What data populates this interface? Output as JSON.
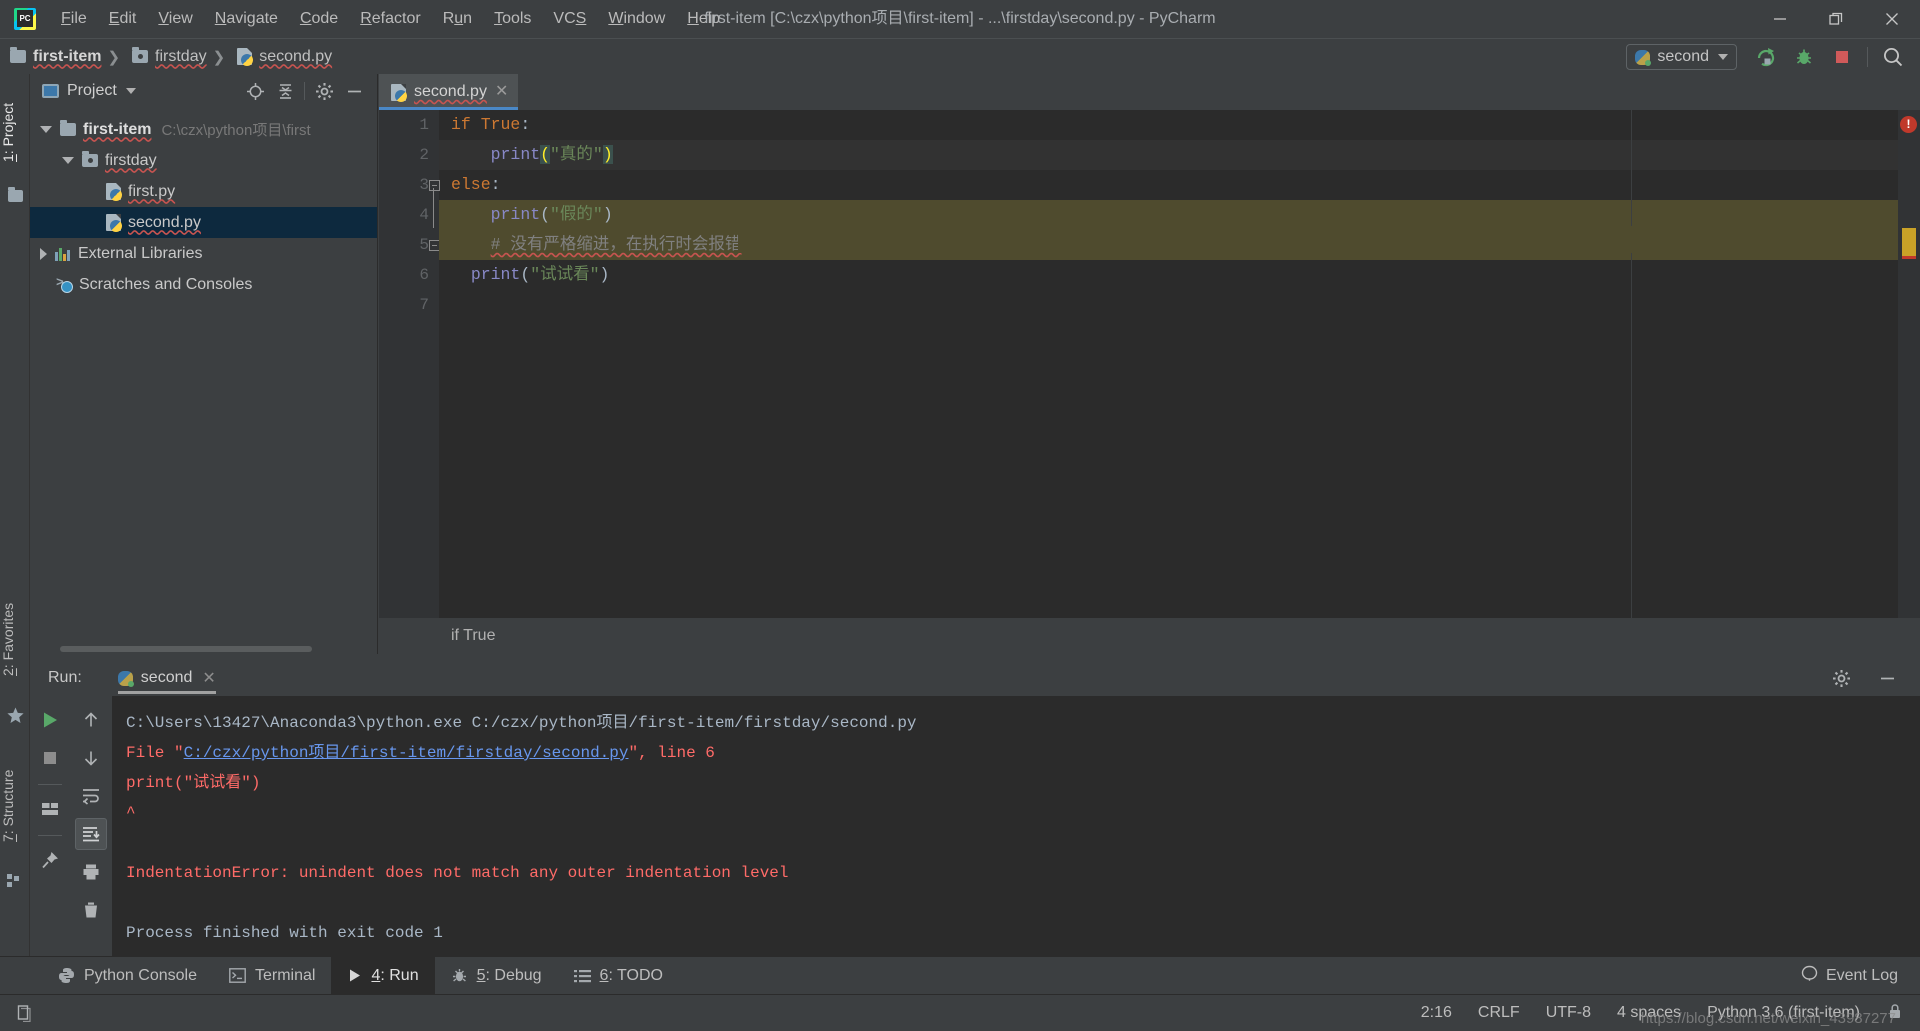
{
  "window": {
    "title": "first-item [C:\\czx\\python项目\\first-item] - ...\\firstday\\second.py - PyCharm",
    "logo_label": "PC",
    "minimize": "—",
    "maximize": "❐",
    "close": "✕"
  },
  "menubar": {
    "items": [
      {
        "label": "File",
        "mnemonic": "F"
      },
      {
        "label": "Edit",
        "mnemonic": "E"
      },
      {
        "label": "View",
        "mnemonic": "V"
      },
      {
        "label": "Navigate",
        "mnemonic": "N"
      },
      {
        "label": "Code",
        "mnemonic": "C"
      },
      {
        "label": "Refactor",
        "mnemonic": "R"
      },
      {
        "label": "Run",
        "mnemonic": "u"
      },
      {
        "label": "Tools",
        "mnemonic": "T"
      },
      {
        "label": "VCS",
        "mnemonic": "S"
      },
      {
        "label": "Window",
        "mnemonic": "W"
      },
      {
        "label": "Help",
        "mnemonic": "H"
      }
    ]
  },
  "navbar": {
    "breadcrumbs": [
      {
        "label": "first-item",
        "icon": "folder-icon"
      },
      {
        "label": "firstday",
        "icon": "source-folder-icon"
      },
      {
        "label": "second.py",
        "icon": "python-file-icon"
      }
    ],
    "separator": "❯",
    "run_config": {
      "name": "second",
      "icon": "python-config-icon"
    },
    "buttons": [
      {
        "name": "rerun-button",
        "icon": "rerun-icon"
      },
      {
        "name": "debug-button",
        "icon": "bug-icon"
      },
      {
        "name": "stop-button",
        "icon": "stop-icon"
      },
      {
        "name": "search-everywhere-button",
        "icon": "search-icon"
      }
    ]
  },
  "left_stripe": {
    "tabs": [
      {
        "label": "1: Project",
        "mnemonic": "1",
        "active": true
      },
      {
        "label": "2: Favorites",
        "mnemonic": "2",
        "active": false
      },
      {
        "label": "7: Structure",
        "mnemonic": "7",
        "active": false
      }
    ]
  },
  "project_panel": {
    "title": "Project",
    "header_buttons": [
      {
        "name": "locate-file-button",
        "icon": "target-icon"
      },
      {
        "name": "collapse-all-button",
        "icon": "collapse-icon"
      },
      {
        "name": "settings-button",
        "icon": "gear-icon"
      },
      {
        "name": "hide-button",
        "icon": "minimize-icon"
      }
    ],
    "tree": [
      {
        "label": "first-item",
        "path": "C:\\czx\\python项目\\first",
        "icon": "folder-icon",
        "state": "expanded",
        "depth": 0,
        "bold": true,
        "selected": false
      },
      {
        "label": "firstday",
        "path": "",
        "icon": "source-folder-icon",
        "state": "expanded",
        "depth": 1,
        "bold": false,
        "selected": false
      },
      {
        "label": "first.py",
        "path": "",
        "icon": "python-file-icon",
        "state": "leaf",
        "depth": 2,
        "bold": false,
        "selected": false
      },
      {
        "label": "second.py",
        "path": "",
        "icon": "python-file-icon",
        "state": "leaf",
        "depth": 2,
        "bold": false,
        "selected": true
      },
      {
        "label": "External Libraries",
        "path": "",
        "icon": "library-icon",
        "state": "collapsed",
        "depth": 0,
        "bold": false,
        "selected": false
      },
      {
        "label": "Scratches and Consoles",
        "path": "",
        "icon": "scratches-icon",
        "state": "leaf",
        "depth": 0,
        "bold": false,
        "selected": false
      }
    ]
  },
  "editor": {
    "tab": {
      "label": "second.py",
      "icon": "python-file-icon",
      "close": "✕"
    },
    "line_numbers": [
      "1",
      "2",
      "3",
      "4",
      "5",
      "6",
      "7"
    ],
    "code": [
      {
        "n": "1",
        "tokens": [
          {
            "t": "if ",
            "c": "kw"
          },
          {
            "t": "True",
            "c": "kw"
          },
          {
            "t": ":",
            "c": "punct"
          }
        ]
      },
      {
        "n": "2",
        "tokens": [
          {
            "t": "    ",
            "c": "punct"
          },
          {
            "t": "print",
            "c": "fn"
          },
          {
            "t": "(",
            "c": "brkt"
          },
          {
            "t": "\"真的\"",
            "c": "str"
          },
          {
            "t": ")",
            "c": "brkt"
          }
        ]
      },
      {
        "n": "3",
        "tokens": [
          {
            "t": "else",
            "c": "kw"
          },
          {
            "t": ":",
            "c": "punct"
          }
        ]
      },
      {
        "n": "4",
        "tokens": [
          {
            "t": "    ",
            "c": "punct"
          },
          {
            "t": "print",
            "c": "fn"
          },
          {
            "t": "(",
            "c": "punct"
          },
          {
            "t": "\"假的\"",
            "c": "str"
          },
          {
            "t": ")",
            "c": "punct"
          }
        ]
      },
      {
        "n": "5",
        "tokens": [
          {
            "t": "    ",
            "c": "punct"
          },
          {
            "t": "# 没有严格缩进，在执行时会报错",
            "c": "cmt"
          }
        ]
      },
      {
        "n": "6",
        "tokens": [
          {
            "t": "  ",
            "c": "punct"
          },
          {
            "t": "print",
            "c": "fn"
          },
          {
            "t": "(",
            "c": "punct"
          },
          {
            "t": "\"试试看\"",
            "c": "str"
          },
          {
            "t": ")",
            "c": "punct"
          }
        ]
      },
      {
        "n": "7",
        "tokens": []
      }
    ],
    "breadcrumb": "if True",
    "error_badge": "!"
  },
  "run_window": {
    "label": "Run:",
    "tab": {
      "name": "second",
      "icon": "python-config-icon",
      "close": "✕"
    },
    "left_toolbar": [
      {
        "name": "rerun-button",
        "icon": "run-icon"
      },
      {
        "name": "stop-button",
        "icon": "stop-icon"
      },
      {
        "name": "layout-button",
        "icon": "layout-icon"
      },
      {
        "name": "pin-tab-button",
        "icon": "pin-icon"
      }
    ],
    "second_toolbar": [
      {
        "name": "up-stack-button",
        "icon": "arrow-up-icon"
      },
      {
        "name": "down-stack-button",
        "icon": "arrow-down-icon"
      },
      {
        "name": "soft-wrap-button",
        "icon": "wrap-icon"
      },
      {
        "name": "scroll-to-end-button",
        "icon": "scroll-end-icon",
        "active": true
      },
      {
        "name": "print-button",
        "icon": "printer-icon"
      },
      {
        "name": "clear-all-button",
        "icon": "trash-icon"
      }
    ],
    "header_buttons": [
      {
        "name": "settings-button",
        "icon": "gear-icon"
      },
      {
        "name": "hide-button",
        "icon": "minimize-icon"
      }
    ],
    "console": [
      {
        "type": "normal",
        "text": "C:\\Users\\13427\\Anaconda3\\python.exe C:/czx/python项目/first-item/firstday/second.py"
      },
      {
        "type": "error-link",
        "prefix": "  File \"",
        "link": "C:/czx/python项目/first-item/firstday/second.py",
        "suffix": "\", line 6"
      },
      {
        "type": "error",
        "text": "    print(\"试试看\")"
      },
      {
        "type": "error",
        "text": "            ^"
      },
      {
        "type": "blank",
        "text": ""
      },
      {
        "type": "error",
        "text": "IndentationError: unindent does not match any outer indentation level"
      },
      {
        "type": "blank",
        "text": ""
      },
      {
        "type": "normal",
        "text": "Process finished with exit code 1"
      }
    ]
  },
  "bottom_tabs": {
    "tabs": [
      {
        "label": "Python Console",
        "mnemonic": "",
        "icon": "python-icon",
        "active": false
      },
      {
        "label": "Terminal",
        "mnemonic": "",
        "icon": "terminal-icon",
        "active": false
      },
      {
        "label": "4: Run",
        "mnemonic": "4",
        "icon": "run-icon",
        "active": true
      },
      {
        "label": "5: Debug",
        "mnemonic": "5",
        "icon": "bug-icon",
        "active": false
      },
      {
        "label": "6: TODO",
        "mnemonic": "6",
        "icon": "todo-icon",
        "active": false
      }
    ],
    "event_log": {
      "label": "Event Log",
      "icon": "balloon-icon"
    }
  },
  "status_bar": {
    "toggle_icon": "toggle-sidebar-icon",
    "caret_position": "2:16",
    "line_separator": "CRLF",
    "encoding": "UTF-8",
    "indent": "4 spaces",
    "interpreter": "Python 3.6 (first-item)",
    "lock_icon": "lock-icon",
    "watermark": "https://blog.csdn.net/weixin_43987277"
  },
  "colors": {
    "bg_chrome": "#3c3f41",
    "bg_editor": "#2b2b2b",
    "accent_blue": "#4a88c7",
    "selection": "#0d293e",
    "warn_band": "#4f4b2e",
    "error_red": "#ff6b68",
    "keyword_orange": "#cc7832",
    "string_green": "#6a8759",
    "function_purple": "#8888c6",
    "comment_gray": "#808080"
  }
}
